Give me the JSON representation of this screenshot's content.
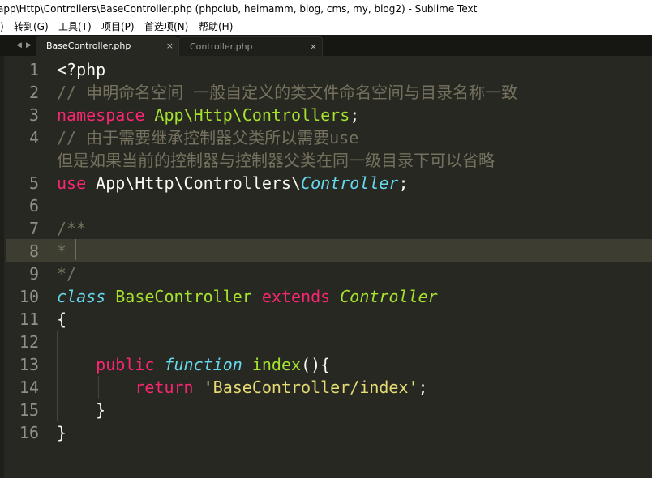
{
  "window": {
    "title": "app\\Http\\Controllers\\BaseController.php (phpclub, heimamm, blog, cms, my, blog2) - Sublime Text"
  },
  "menu": [
    {
      "label": ")"
    },
    {
      "label": "转到(G)"
    },
    {
      "label": "工具(T)"
    },
    {
      "label": "项目(P)"
    },
    {
      "label": "首选项(N)"
    },
    {
      "label": "帮助(H)"
    }
  ],
  "tabs": [
    {
      "label": "BaseController.php",
      "close": "×",
      "active": true
    },
    {
      "label": "Controller.php",
      "close": "×",
      "active": false
    }
  ],
  "nav": {
    "left": "◀",
    "right": "▶"
  },
  "gutter": [
    "1",
    "2",
    "3",
    "4",
    "",
    "5",
    "6",
    "7",
    "8",
    "9",
    "10",
    "11",
    "12",
    "13",
    "14",
    "15",
    "16"
  ],
  "code": {
    "l1": "<?php",
    "l2": "// 申明命名空间 一般自定义的类文件命名空间与目录名称一致",
    "l3_kw": "namespace",
    "l3_ns": "App\\Http\\Controllers",
    "l3_end": ";",
    "l4": "// 由于需要继承控制器父类所以需要use",
    "l4b": "但是如果当前的控制器与控制器父类在同一级目录下可以省略",
    "l5_kw": "use",
    "l5_ns": "App\\Http\\Controllers\\",
    "l5_cls": "Controller",
    "l5_end": ";",
    "l7": "/**",
    "l8": "*",
    "l9": "*/",
    "l10_kw": "class",
    "l10_name": "BaseController",
    "l10_ext": "extends",
    "l10_parent": "Controller",
    "l11": "{",
    "l13_public": "public",
    "l13_function": "function",
    "l13_name": "index",
    "l13_rest": "(){",
    "l14_return": "return",
    "l14_str": "'BaseController/index'",
    "l14_end": ";",
    "l15": "}",
    "l16": "}"
  },
  "colors": {
    "background": "#272822",
    "comment": "#75715e",
    "keyword": "#f92672",
    "entity": "#a6e22e",
    "type": "#66d9ef",
    "string": "#e6db74",
    "text": "#f8f8f2"
  }
}
